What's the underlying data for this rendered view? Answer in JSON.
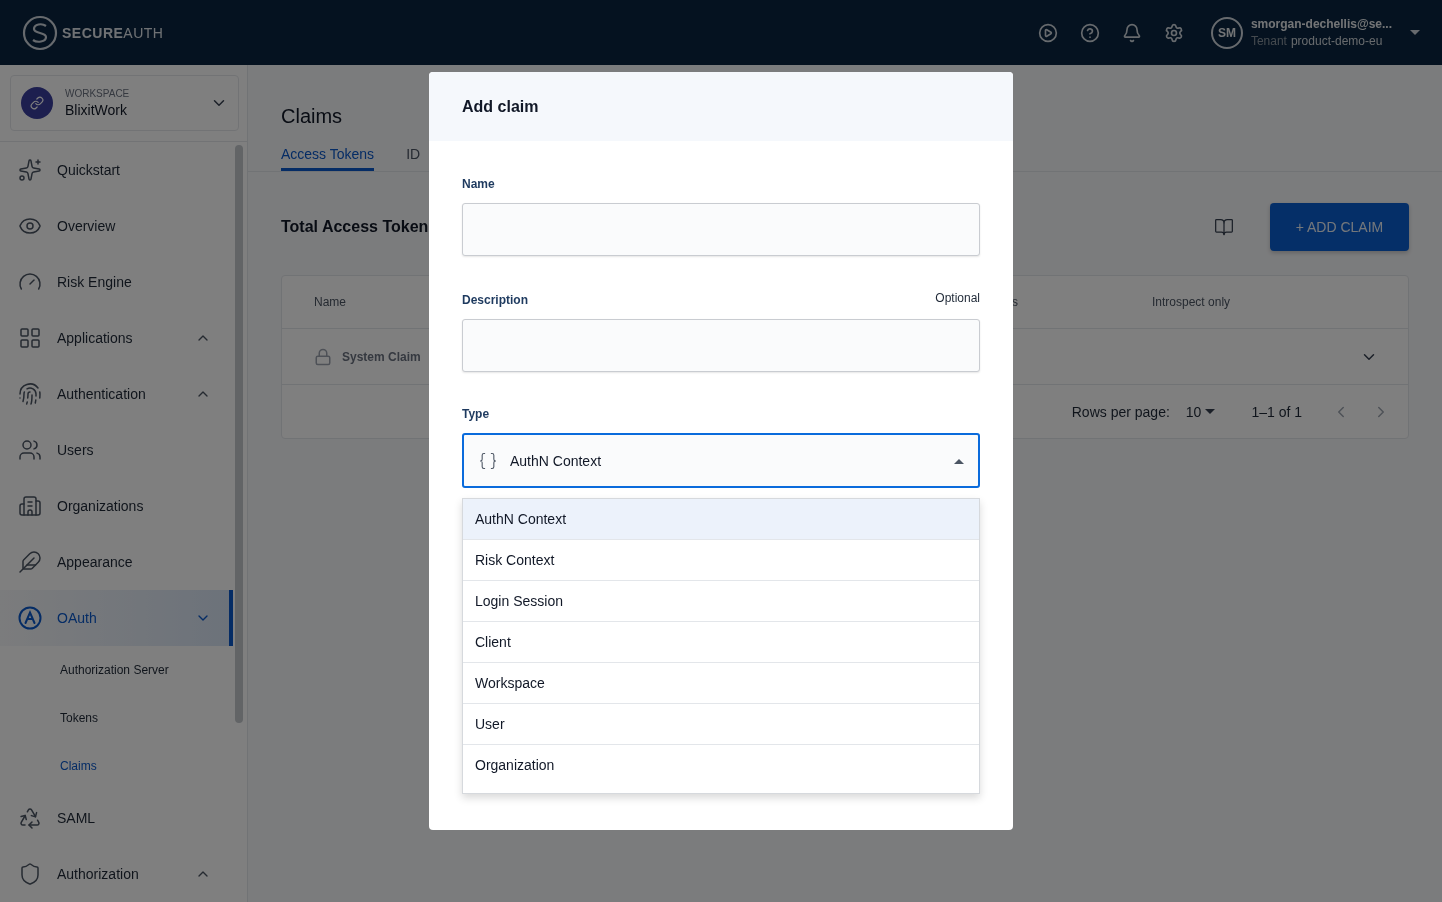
{
  "header": {
    "logo": "**SECURE**AUTH",
    "user": {
      "initials": "SM",
      "email": "smorgan-dechellis@se...",
      "tenant_label": "Tenant",
      "tenant": "product-demo-eu"
    }
  },
  "workspace": {
    "label": "WORKSPACE",
    "name": "BlixitWork"
  },
  "sidebar": {
    "items": [
      {
        "label": "Quickstart",
        "selected": false
      },
      {
        "label": "Overview",
        "selected": false
      },
      {
        "label": "Risk Engine",
        "selected": false
      },
      {
        "label": "Applications",
        "selected": false,
        "expanded": false
      },
      {
        "label": "Authentication",
        "selected": false,
        "expanded": false
      },
      {
        "label": "Users",
        "selected": false
      },
      {
        "label": "Organizations",
        "selected": false
      },
      {
        "label": "Appearance",
        "selected": false
      },
      {
        "label": "OAuth",
        "selected": true,
        "expanded": true,
        "children": [
          {
            "label": "Authorization Server",
            "selected": false
          },
          {
            "label": "Tokens",
            "selected": false
          },
          {
            "label": "Claims",
            "selected": true
          }
        ]
      },
      {
        "label": "SAML",
        "selected": false
      },
      {
        "label": "Authorization",
        "selected": false,
        "expanded": false
      }
    ]
  },
  "page": {
    "title": "Claims",
    "tabs": [
      {
        "label": "Access Tokens",
        "selected": true
      },
      {
        "label": "ID",
        "selected": false
      }
    ],
    "section_title": "Total Access Token",
    "add_button": "+ ADD CLAIM",
    "table": {
      "columns": [
        "Name",
        "s",
        "Introspect only"
      ],
      "rows": [
        {
          "name": "System Claim"
        }
      ],
      "rows_per_page_label": "Rows per page:",
      "rows_per_page": "10",
      "range": "1–1 of 1"
    }
  },
  "modal": {
    "title": "Add claim",
    "fields": [
      {
        "label": "Name"
      },
      {
        "label": "Description",
        "hint": "Optional"
      }
    ],
    "type": {
      "label": "Type",
      "value": "AuthN Context",
      "expanded": true,
      "options": [
        {
          "label": "AuthN Context",
          "selected": true
        },
        {
          "label": "Risk Context",
          "selected": false
        },
        {
          "label": "Login Session",
          "selected": false
        },
        {
          "label": "Client",
          "selected": false
        },
        {
          "label": "Workspace",
          "selected": false
        },
        {
          "label": "User",
          "selected": false
        },
        {
          "label": "Organization",
          "selected": false
        }
      ]
    }
  }
}
